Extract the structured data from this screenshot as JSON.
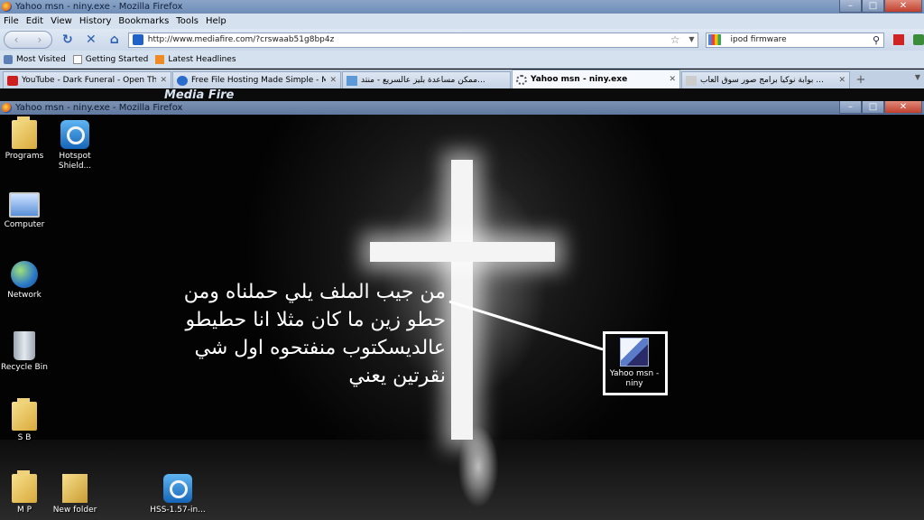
{
  "window": {
    "title": "Yahoo msn - niny.exe - Mozilla Firefox",
    "controls": {
      "minimize": "–",
      "maximize": "□",
      "close": "✕"
    }
  },
  "menu": [
    "File",
    "Edit",
    "View",
    "History",
    "Bookmarks",
    "Tools",
    "Help"
  ],
  "navigation": {
    "back_icon": "‹",
    "forward_icon": "›",
    "reload_icon": "↻",
    "stop_icon": "✕",
    "home_icon": "⌂",
    "url": "http://www.mediafire.com/?crswaab51g8bp4z",
    "search_value": "ipod firmware",
    "search_go_icon": "⚲"
  },
  "bookmarks": [
    "Most Visited",
    "Getting Started",
    "Latest Headlines"
  ],
  "tabs": [
    {
      "label": "YouTube - Dark Funeral - Open The...",
      "icon": "youtube-icon",
      "active": false
    },
    {
      "label": "Free File Hosting Made Simple - Me...",
      "icon": "mediafire-icon",
      "active": false
    },
    {
      "label": "ممكن مساعدة بليز عالسريع - منتد...",
      "icon": "forum-icon",
      "active": false
    },
    {
      "label": "Yahoo msn - niny.exe",
      "icon": "loading-icon",
      "active": true
    },
    {
      "label": "بوابة نوكيا برامج صور سوق العاب ...",
      "icon": "nokia-icon",
      "active": false
    }
  ],
  "new_tab": "+",
  "page": {
    "logo_fragment": "Media Fire",
    "inner_window_title": "Yahoo msn - niny.exe - Mozilla Firefox",
    "desktop_icons": {
      "programs": "Programs",
      "hotspot": "Hotspot Shield...",
      "computer": "Computer",
      "network": "Network",
      "recycle": "Recycle Bin",
      "sb": "S B",
      "mp": "M P",
      "newfolder": "New folder",
      "hss": "HSS-1.57-in...",
      "yahoo": "Yahoo msn - niny"
    },
    "annotation_lines": [
      "من جيب الملف يلي حملناه ومن",
      "حطو زين ما كان مثلا انا حطيطو",
      "عالديسكتوب منفتحوه اول شي",
      "نقرتين يعني"
    ]
  }
}
